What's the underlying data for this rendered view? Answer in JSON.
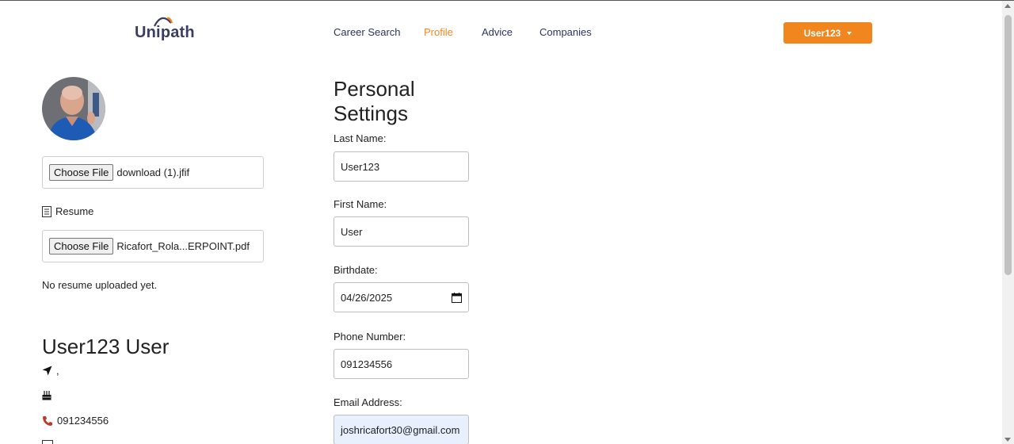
{
  "brand": {
    "name": "Unipath",
    "accent": "#f0861d",
    "navy": "#2d3360"
  },
  "nav": {
    "items": [
      {
        "label": "Career Search",
        "active": false
      },
      {
        "label": "Profile",
        "active": true
      },
      {
        "label": "Advice",
        "active": false
      },
      {
        "label": "Companies",
        "active": false
      }
    ],
    "user_menu_label": "User123"
  },
  "profile": {
    "photo_file": {
      "button_label": "Choose File",
      "file_name": "download (1).jfif"
    },
    "resume_label": "Resume",
    "resume_file": {
      "button_label": "Choose File",
      "file_name": "Ricafort_Rola...ERPOINT.pdf"
    },
    "no_resume_text": "No resume uploaded yet.",
    "full_name": "User123 User",
    "location": ",",
    "birthday": "",
    "phone": "091234556"
  },
  "settings": {
    "title": "Personal Settings",
    "fields": {
      "last_name": {
        "label": "Last Name:",
        "value": "User123"
      },
      "first_name": {
        "label": "First Name:",
        "value": "User"
      },
      "birthdate": {
        "label": "Birthdate:",
        "value": "04/26/2025"
      },
      "phone": {
        "label": "Phone Number:",
        "value": "091234556"
      },
      "email": {
        "label": "Email Address:",
        "value": "joshricafort30@gmail.com"
      }
    }
  }
}
